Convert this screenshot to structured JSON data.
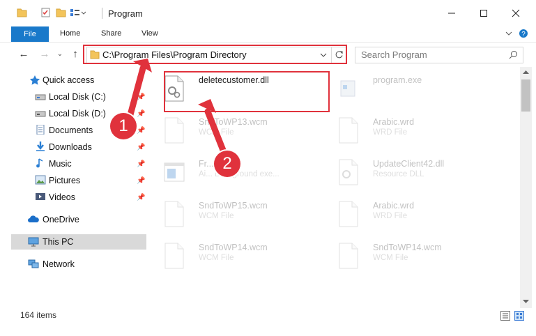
{
  "window": {
    "title": "Program",
    "minimize_icon": "minimize-icon",
    "maximize_icon": "maximize-icon",
    "close_icon": "close-icon"
  },
  "ribbon": {
    "tabs": [
      "File",
      "Home",
      "Share",
      "View"
    ],
    "help_icon": "help-icon"
  },
  "address": {
    "path": "C:\\Program Files\\Program Directory",
    "search_placeholder": "Search Program"
  },
  "sidebar": {
    "items": [
      {
        "label": "Quick access",
        "icon": "star-icon"
      },
      {
        "label": "Local Disk (C:)",
        "icon": "drive-icon",
        "pinned": true
      },
      {
        "label": "Local Disk (D:)",
        "icon": "drive-icon",
        "pinned": true
      },
      {
        "label": "Documents",
        "icon": "documents-icon",
        "pinned": true
      },
      {
        "label": "Downloads",
        "icon": "downloads-icon",
        "pinned": true
      },
      {
        "label": "Music",
        "icon": "music-icon",
        "pinned": true
      },
      {
        "label": "Pictures",
        "icon": "pictures-icon",
        "pinned": true
      },
      {
        "label": "Videos",
        "icon": "videos-icon",
        "pinned": true
      },
      {
        "label": "OneDrive",
        "icon": "onedrive-icon"
      },
      {
        "label": "This PC",
        "icon": "pc-icon",
        "selected": true
      },
      {
        "label": "Network",
        "icon": "network-icon"
      }
    ]
  },
  "files": [
    {
      "name": "deletecustomer.dll",
      "sub": "",
      "highlighted": true
    },
    {
      "name": "program.exe",
      "sub": ""
    },
    {
      "name": "SndToWP13.wcm",
      "sub": "WCM File"
    },
    {
      "name": "Arabic.wrd",
      "sub": "WRD File"
    },
    {
      "name": "Fr...exe",
      "sub": "Ai... Background exe..."
    },
    {
      "name": "UpdateClient42.dll",
      "sub": "Resource DLL"
    },
    {
      "name": "SndToWP15.wcm",
      "sub": "WCM File"
    },
    {
      "name": "Arabic.wrd",
      "sub": "WRD File"
    },
    {
      "name": "SndToWP14.wcm",
      "sub": "WCM File"
    },
    {
      "name": "SndToWP14.wcm",
      "sub": "WCM File"
    }
  ],
  "status": {
    "item_count": "164 items"
  },
  "annotations": {
    "step1": "1",
    "step2": "2",
    "color": "#e0323c"
  },
  "colors": {
    "accent": "#1979ca",
    "selected_bg": "#d9d9d9"
  }
}
